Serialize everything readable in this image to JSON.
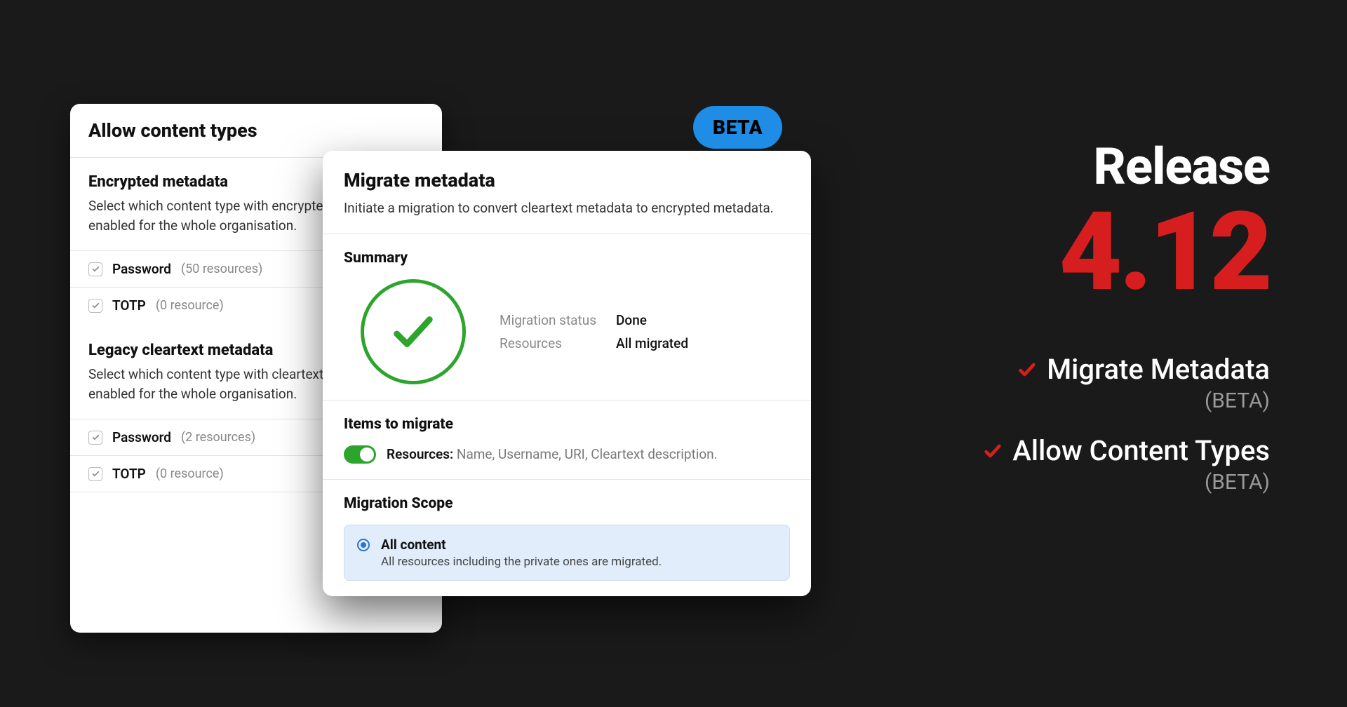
{
  "beta_badge": "BETA",
  "allow_card": {
    "title": "Allow content types",
    "encrypted": {
      "heading": "Encrypted metadata",
      "desc": "Select which content type with encrypted metadata is enabled for the whole organisation.",
      "rows": [
        {
          "label": "Password",
          "count": "(50 resources)"
        },
        {
          "label": "TOTP",
          "count": "(0 resource)"
        }
      ]
    },
    "legacy": {
      "heading": "Legacy cleartext metadata",
      "desc": "Select which content type with cleartext metadata is enabled for the whole organisation.",
      "rows": [
        {
          "label": "Password",
          "count": "(2 resources)"
        },
        {
          "label": "TOTP",
          "count": "(0 resource)"
        }
      ]
    }
  },
  "migrate_card": {
    "title": "Migrate metadata",
    "desc": "Initiate a migration to convert cleartext metadata to encrypted metadata.",
    "summary_heading": "Summary",
    "kv": {
      "status_label": "Migration status",
      "status_value": "Done",
      "resources_label": "Resources",
      "resources_value": "All migrated"
    },
    "items_heading": "Items to migrate",
    "items_label": "Resources:",
    "items_value": " Name, Username, URI, Cleartext description.",
    "scope_heading": "Migration Scope",
    "scope_option": {
      "title": "All content",
      "desc": "All resources including the private ones are migrated."
    }
  },
  "release": {
    "word": "Release",
    "version": "4.12",
    "features": [
      {
        "title": "Migrate Metadata",
        "sub": "(BETA)"
      },
      {
        "title": "Allow Content Types",
        "sub": "(BETA)"
      }
    ]
  }
}
